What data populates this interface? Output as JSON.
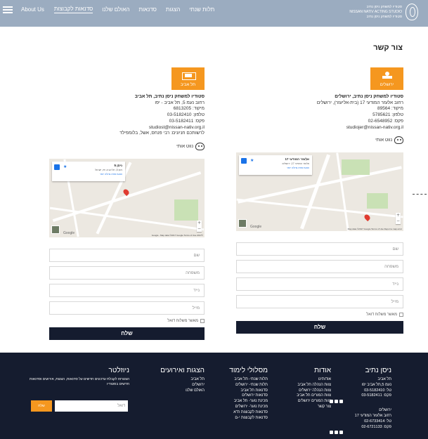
{
  "header": {
    "nav": [
      {
        "label": "About Us"
      },
      {
        "label": "סדנאות לקבוצות"
      },
      {
        "label": "האולם שלנו"
      },
      {
        "label": "סדנאות"
      },
      {
        "label": "הצגות"
      },
      {
        "label": "תלות שנתי"
      }
    ],
    "brand_lines": [
      "סטודיו למשחק ניסן נתיב",
      "NISSAN NATIV ACTING STUDIO",
      "סטודיו למשחק ניסן נתיב"
    ]
  },
  "page_title": "צור קשר",
  "branches": [
    {
      "button_label": "ירושלים",
      "name": "סטודיו למשחק ניסן נתיב, ירושלים",
      "lines": [
        "רחוב אלעזר המודעי 17 (בית-אליעזר), ירושלים",
        "מיקוד: 89564",
        "טלפון: 5785621",
        "פקס: 02-6548952",
        "studiojer@nissan-nativ.org.il"
      ],
      "waze": "נווט אותי",
      "map": {
        "title": "אלעזר המודעי 17",
        "subtitle": "אלעזר המודעי 17, ירושלים",
        "link": "הצגת מפה גדולה יותר",
        "footer": "Map data ©2017 Google  Terms of Use  Report a map error"
      }
    },
    {
      "button_label": "תל אביב",
      "name": "סטודיו למשחק ניסן נתיב, תל אביב",
      "lines": [
        "רחוב נעמ 5, תל אביב - יפו",
        "מיקוד: 6813205",
        "טלפון: 03-5182410",
        "פקס: 03-5182411",
        "studiost@nissan-nativ.org.il",
        "לרשותכם חניונים: רבי פנחס, אשל, בלומפילד"
      ],
      "waze": "נווט אותי",
      "map": {
        "title": "ניסן 5",
        "subtitle": "ניסן 5, תל אביב-יפו, ישראל",
        "link": "הצגת מפה גדולה יותר",
        "footer": "©2017 Google - Map data ©2017 Google  Terms of Use"
      }
    }
  ],
  "form": {
    "fields": [
      "שם",
      "משפחה",
      "נייד",
      "מייל"
    ],
    "consent": "מאשר משלוח דואל",
    "send": "שלח"
  },
  "footer": {
    "brand": {
      "title": "ניסן נתיב",
      "tel_aviv_lines": [
        "תל אביב",
        "נעמ 5,תל אביב יפו",
        "טל: 03-5182410",
        "פקס: 03-5182411"
      ],
      "jerusalem_lines": [
        "ירושלים",
        "רחוב אלעזר המודעי 17",
        "טל: 02-6733414",
        "פקס: 02-6721133"
      ]
    },
    "about": {
      "title": "אודות",
      "links": [
        "אודותינו",
        "צוות הנהלה תל אביב",
        "צוות הנהלה ירושלים",
        "צוות המורים תל אביב",
        "צוות המורים ירושלים",
        "צור קשר"
      ]
    },
    "programs": {
      "title": "מסלולי לימוד",
      "links": [
        "תלות שנתי- תל אביב",
        "תלות שנתי- ירושלים",
        "סדנאות תל אביב",
        "סדנאות ירושלים",
        "מכינת נוער- תל אביב",
        "מכינת נוער- ירושלים",
        "סדנאות לקבוצות ת\"א",
        "סדנאות לקבוצות י-ם"
      ]
    },
    "events": {
      "title": "הצגות ואירועים",
      "links": [
        "תל אביב",
        "ירושלים",
        "האולם שלנו"
      ]
    },
    "newsletter": {
      "title": "ניוזלטר",
      "desc_lines": [
        "הצטרפו לקבלת עדכונים חדשים על סדנאות, הצגות, אירועים וסדנאות",
        "חדשים בסטודיו"
      ],
      "placeholder": "דואל",
      "button": "שלח"
    }
  },
  "colors": {
    "header": "#9bacc0",
    "accent": "#f5971f",
    "dark": "#151c2f"
  }
}
